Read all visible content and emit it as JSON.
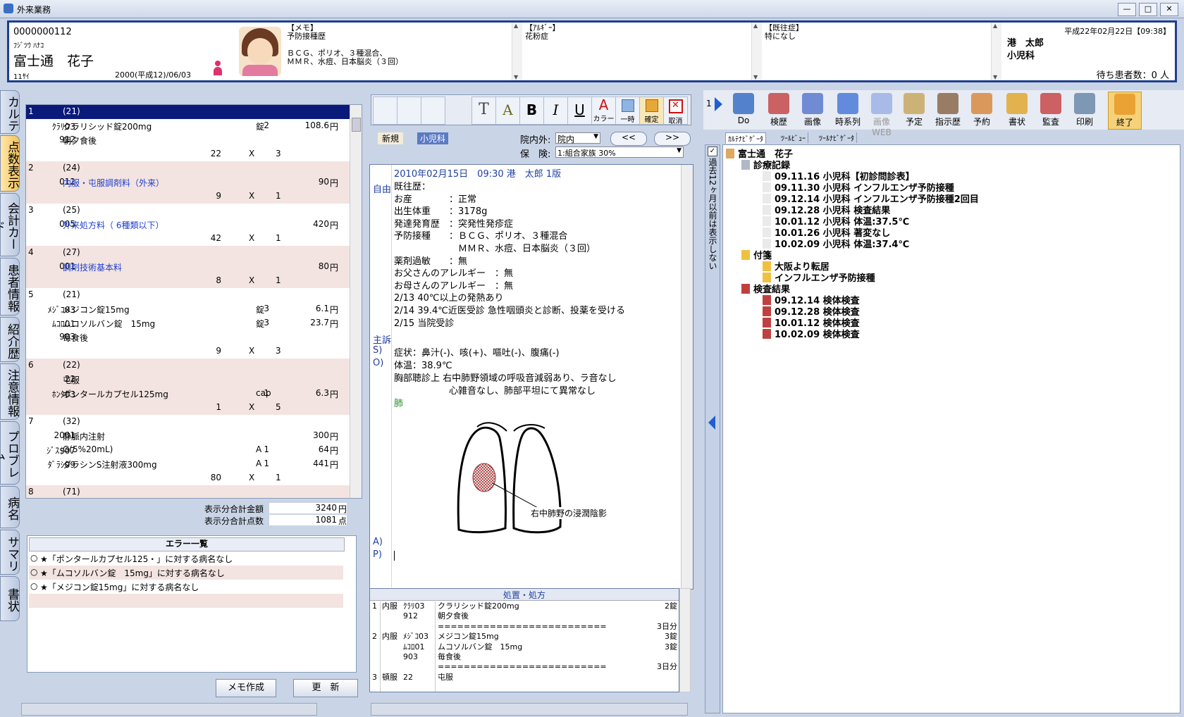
{
  "window": {
    "title": "外来業務",
    "min": "—",
    "max": "□",
    "close": "✕"
  },
  "patient": {
    "id": "0000000112",
    "kana": "ﾌｼﾞﾂｳ ﾊﾅｺ",
    "name": "富士通　花子",
    "age": "11ｻｲ",
    "dob": "2000(平成12)/06/03"
  },
  "memo": {
    "title": "【メモ】",
    "text": "予防接種歴\n\nＢＣＧ、ポリオ、３種混合、\nＭＭＲ、水痘、日本脳炎（３回）"
  },
  "allergy": {
    "title": "【ｱﾙｷﾞｰ】",
    "text": "花粉症"
  },
  "history": {
    "title": "【既往症】",
    "text": "特になし"
  },
  "doctor": {
    "datetime": "平成22年02月22日【09:38】",
    "name": "港　太郎",
    "dept": "小児科",
    "waiting": "待ち患者数：0 人"
  },
  "sidetabs": [
    "カルテ",
    "点数表示",
    "会計カード",
    "患者情報",
    "紹介歴",
    "注意情報",
    "プロブレム",
    "病名",
    "サマリ",
    "書状"
  ],
  "orders": [
    {
      "no": "1",
      "code": "(21)",
      "rows": [
        {
          "c": "ｸﾗﾘ03",
          "n": "クラリシッド錠200mg",
          "q": "2",
          "u": "錠",
          "p": "108.6",
          "y": "円"
        },
        {
          "c": "912",
          "n": "朝夕食後"
        }
      ],
      "tail": {
        "a": "22",
        "x": "X",
        "b": "3"
      },
      "sel": true
    },
    {
      "no": "2",
      "code": "(24)",
      "rows": [
        {
          "c": "012",
          "n": "内服・屯服調剤料（外来）",
          "p": "90",
          "y": "円",
          "blue": true
        }
      ],
      "tail": {
        "a": "9",
        "x": "X",
        "b": "1"
      }
    },
    {
      "no": "3",
      "code": "(25)",
      "rows": [
        {
          "c": "005",
          "n": "外来処方料（ 6種類以下）",
          "p": "420",
          "y": "円",
          "blue": true
        }
      ],
      "tail": {
        "a": "42",
        "x": "X",
        "b": "1"
      }
    },
    {
      "no": "4",
      "code": "(27)",
      "rows": [
        {
          "c": "001",
          "n": "調剤技術基本料",
          "p": "80",
          "y": "円",
          "blue": true
        }
      ],
      "tail": {
        "a": "8",
        "x": "X",
        "b": "1"
      }
    },
    {
      "no": "5",
      "code": "(21)",
      "rows": [
        {
          "c": "ﾒｼﾞｺ03",
          "n": "メジコン錠15mg",
          "q": "3",
          "u": "錠",
          "p": "6.1",
          "y": "円"
        },
        {
          "c": "ﾑｺﾛ01",
          "n": "ムコソルバン錠　15mg",
          "q": "3",
          "u": "錠",
          "p": "23.7",
          "y": "円"
        },
        {
          "c": "903",
          "n": "毎食後"
        }
      ],
      "tail": {
        "a": "9",
        "x": "X",
        "b": "3"
      }
    },
    {
      "no": "6",
      "code": "(22)",
      "rows": [
        {
          "c": "22",
          "n": "屯服"
        },
        {
          "c": "ﾎﾝﾀ03",
          "n": "ポンタールカプセル125mg",
          "q": "1",
          "u": "cap",
          "p": "6.3",
          "y": "円"
        }
      ],
      "tail": {
        "a": "1",
        "x": "X",
        "b": "5"
      }
    },
    {
      "no": "7",
      "code": "(32)",
      "rows": [
        {
          "c": "2001",
          "n": "静脈内注射",
          "p": "300",
          "y": "円"
        },
        {
          "c": "ｼﾞｽ$07",
          "n": "G(5%20mL)",
          "q": "1",
          "u": "A",
          "p": "64",
          "y": "円"
        },
        {
          "c": "ﾀﾞﾗｼ09",
          "n": "ダラシンS注射液300mg",
          "q": "1",
          "u": "A",
          "p": "441",
          "y": "円"
        }
      ],
      "tail": {
        "a": "80",
        "x": "X",
        "b": "1"
      }
    },
    {
      "no": "8",
      "code": "(71)",
      "rows": [],
      "tail": null
    }
  ],
  "totals": {
    "amount_label": "表示分合計金額",
    "amount": "3240",
    "amount_unit": "円",
    "points_label": "表示分合計点数",
    "points": "1081",
    "points_unit": "点"
  },
  "errors": {
    "title": "エラー一覧",
    "items": [
      "★「ポンタールカプセル125・」に対する病名なし",
      "★「ムコソルバン錠　15mg」に対する病名なし",
      "★「メジコン錠15mg」に対する病名なし"
    ]
  },
  "buttons": {
    "memo": "メモ作成",
    "update": "更　新"
  },
  "center_toolbar": {
    "color": "カラー",
    "temp": "一時",
    "confirm": "確定",
    "cancel": "取消"
  },
  "visit": {
    "new": "新規",
    "dept": "小児科",
    "inout_label": "院内外:",
    "inout": "院内",
    "ins_label": "保　険:",
    "ins": "1:組合家族 30%",
    "prev": "<<",
    "next": ">>"
  },
  "karte": {
    "header": "2010年02月15日　09:30 港　太郎 1版",
    "labels": {
      "free": "自由",
      "cc": "主訴",
      "s": "S)",
      "o": "O)",
      "lung": "肺",
      "a": "A)",
      "p": "P)"
    },
    "lines": [
      "既往歴：",
      "お産　　　　：正常",
      "出生体重　　：3178g",
      "発達発育歴　：突発性発疹症",
      "予防接種　　：ＢＣＧ、ポリオ、３種混合",
      "　　　　　　　ＭＭＲ、水痘、日本脳炎（３回）",
      "薬剤過敏　　：無",
      "お父さんのアレルギー　：無",
      "お母さんのアレルギー　：無",
      "2/13 40℃以上の発熱あり",
      "2/14 39.4℃近医受診 急性咽頭炎と診断、投薬を受ける",
      "2/15 当院受診"
    ],
    "sym": "症状：鼻汁(-)、咳(+)、嘔吐(-)、腹痛(-)",
    "temp": "体温：38.9℃",
    "chest1": "胸部聴診上 右中肺野領域の呼吸音減弱あり、ラ音なし",
    "chest2": "　　　　　　心雑音なし、肺部平坦にて異常なし",
    "img_label": "右中肺野の浸潤陰影"
  },
  "rx": {
    "title": "処置・処方",
    "rows": [
      {
        "n": "1",
        "k": "内服",
        "c": "ｸﾗﾘ03",
        "d": "クラリシッド錠200mg",
        "q": "2錠"
      },
      {
        "n": "",
        "k": "",
        "c": "912",
        "d": "朝夕食後",
        "q": ""
      },
      {
        "n": "",
        "k": "",
        "c": "",
        "d": "================================",
        "q": "3日分"
      },
      {
        "n": "2",
        "k": "内服",
        "c": "ﾒｼﾞｺ03",
        "d": "メジコン錠15mg",
        "q": "3錠"
      },
      {
        "n": "",
        "k": "",
        "c": "ﾑｺﾛ01",
        "d": "ムコソルバン錠　15mg",
        "q": "3錠"
      },
      {
        "n": "",
        "k": "",
        "c": "903",
        "d": "毎食後",
        "q": ""
      },
      {
        "n": "",
        "k": "",
        "c": "",
        "d": "================================",
        "q": "3日分"
      },
      {
        "n": "3",
        "k": "頓服",
        "c": "22",
        "d": "屯服",
        "q": ""
      }
    ]
  },
  "right_toolbar": {
    "page": "1",
    "items": [
      "Do",
      "検歴",
      "画像",
      "時系列",
      "画像WEB",
      "予定",
      "指示歴",
      "予約",
      "書状",
      "監査",
      "印刷",
      "終了"
    ]
  },
  "right_side_label": "過去12ヶ月以前は表示しない",
  "right_tabs": [
    "ｶﾙﾃﾅﾋﾞｹﾞｰﾀ",
    "ﾂｰﾙﾋﾞｭｰ",
    "ﾂｰﾙﾅﾋﾞｹﾞｰﾀ"
  ],
  "tree": {
    "root": "富士通　花子",
    "records_label": "診療記録",
    "records": [
      "09.11.16 小児科【初診問診表】",
      "09.11.30 小児科 インフルエンザ予防接種",
      "09.12.14 小児科 インフルエンザ予防接種2回目",
      "09.12.28 小児科 検査結果",
      "10.01.12 小児科 体温:37.5℃",
      "10.01.26 小児科 著変なし",
      "10.02.09 小児科 体温:37.4℃"
    ],
    "notes_label": "付箋",
    "notes": [
      "大阪より転居",
      "インフルエンザ予防接種"
    ],
    "labs_label": "検査結果",
    "labs": [
      "09.12.14 検体検査",
      "09.12.28 検体検査",
      "10.01.12 検体検査",
      "10.02.09 検体検査"
    ]
  }
}
